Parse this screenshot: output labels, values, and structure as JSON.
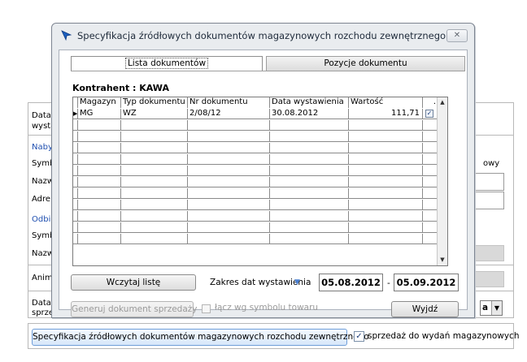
{
  "background": {
    "labels": {
      "date_top": "Data",
      "date_top_2": "wysta",
      "buyer": "Naby",
      "symbol_1": "Symb",
      "name_1": "Nazw",
      "address": "Adre",
      "recipient": "Odbi",
      "symbol_2": "Symb",
      "name_2": "Nazw",
      "anim": "Anim",
      "date_bottom": "Data",
      "date_bottom_2": "sprze",
      "right_fragment": "owy"
    },
    "combo_value": "a",
    "spec_button_label": "Specyfikacja źródłowych dokumentów magazynowych rozchodu zewnętrznego",
    "sales_checkbox_label": "sprzedaż do wydań magazynowych",
    "sales_checkbox_checked": true
  },
  "dialog": {
    "title": "Specyfikacja źródłowych dokumentów magazynowych rozchodu zewnętrznego",
    "close_label": "✕",
    "tabs": [
      {
        "label": "Lista dokumentów",
        "active": true
      },
      {
        "label": "Pozycje dokumentu",
        "active": false
      }
    ],
    "contractor": "Kontrahent : KAWA",
    "grid": {
      "columns": [
        "Magazyn",
        "Typ dokumentu",
        "Nr dokumentu",
        "Data wystawienia",
        "Wartość",
        "."
      ],
      "rows": [
        {
          "warehouse": "MG",
          "doc_type": "WZ",
          "doc_no": "2/08/12",
          "issue_date": "30.08.2012",
          "value": "111,71",
          "checked": true
        }
      ]
    },
    "load_button": "Wczytaj listę",
    "date_range_label": "Zakres dat wystawienia",
    "date_from": "05.08.2012",
    "date_separator": "-",
    "date_to": "05.09.2012",
    "generate_button": "Generuj dokument sprzedaży",
    "group_checkbox_label": "łącz wg symbolu towaru",
    "exit_button": "Wyjdź"
  }
}
